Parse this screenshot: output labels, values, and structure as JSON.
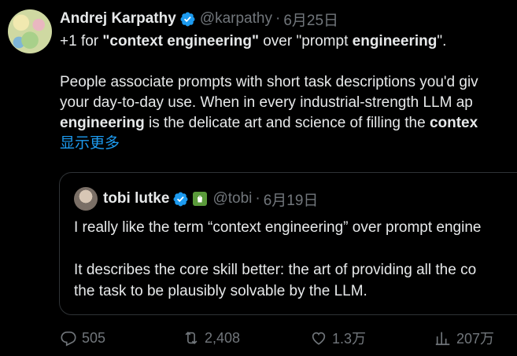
{
  "author": {
    "name": "Andrej Karpathy",
    "handle": "@karpathy",
    "separator": "·",
    "date": "6月25日"
  },
  "tweet": {
    "line1_prefix": "+1 for ",
    "line1_bold1": "\"context engineering\"",
    "line1_mid": " over \"prompt ",
    "line1_bold2": "engineering",
    "line1_suffix": "\".",
    "line2": "People associate prompts with short task descriptions you'd giv",
    "line3": "your day-to-day use. When in every industrial-strength LLM ap",
    "line4_bold1": "engineering",
    "line4_mid": " is the delicate art and science of filling the ",
    "line4_bold2": "contex",
    "show_more": "显示更多"
  },
  "quote": {
    "name": "tobi lutke",
    "handle": "@tobi",
    "separator": "·",
    "date": "6月19日",
    "line1": "I really like the term “context engineering” over prompt engine",
    "line2": "It describes the core skill better: the art of providing all the co",
    "line3": "the task to be plausibly solvable by the LLM."
  },
  "actions": {
    "replies": "505",
    "retweets": "2,408",
    "likes": "1.3万",
    "views": "207万"
  },
  "colors": {
    "background": "#000000",
    "text": "#e7e9ea",
    "muted": "#71767b",
    "link": "#1d9bf0",
    "verified": "#1d9bf0",
    "border": "#2f3336"
  },
  "icons": [
    "verified-badge-icon",
    "shop-badge-icon",
    "reply-icon",
    "retweet-icon",
    "like-icon",
    "views-icon"
  ]
}
